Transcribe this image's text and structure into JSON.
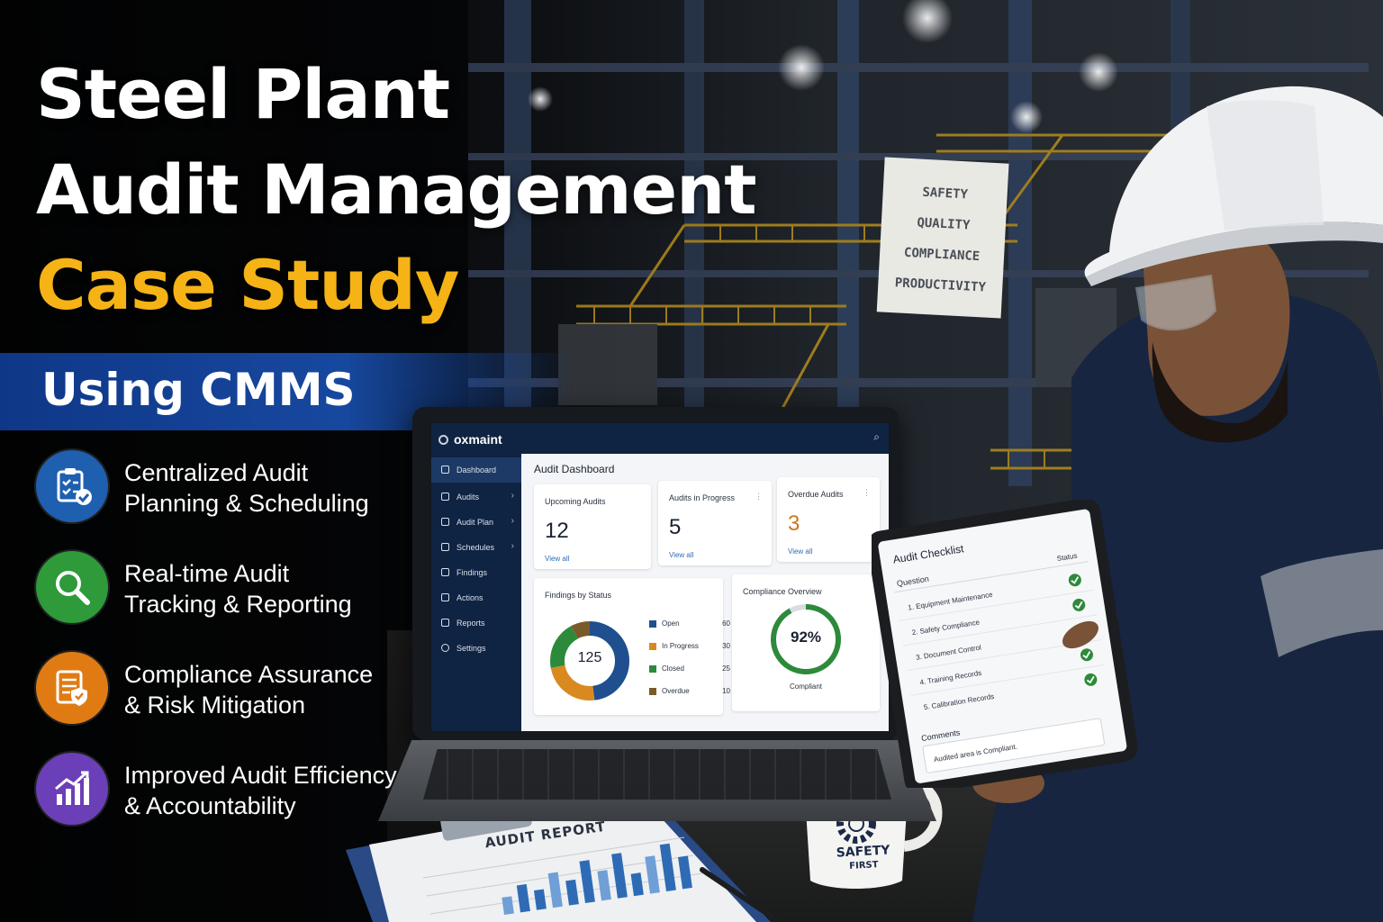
{
  "headline": {
    "line1": "Steel Plant",
    "line2": "Audit Management",
    "line3": "Case Study",
    "banner": "Using CMMS"
  },
  "features": [
    {
      "icon": "clipboard-check-icon",
      "color": "#1f5fb0",
      "line1": "Centralized Audit",
      "line2": "Planning & Scheduling"
    },
    {
      "icon": "magnifier-icon",
      "color": "#2e9a3a",
      "line1": "Real-time Audit",
      "line2": "Tracking & Reporting"
    },
    {
      "icon": "shield-document-icon",
      "color": "#e07b14",
      "line1": "Compliance Assurance",
      "line2": "& Risk Mitigation"
    },
    {
      "icon": "growth-chart-icon",
      "color": "#6b3fb8",
      "line1": "Improved Audit Efficiency",
      "line2": "& Accountability"
    }
  ],
  "sign": {
    "lines": [
      "SAFETY",
      "QUALITY",
      "COMPLIANCE",
      "PRODUCTIVITY"
    ]
  },
  "laptop": {
    "brand": "oxmaint",
    "search_icon": "⌕",
    "nav": [
      {
        "label": "Dashboard",
        "icon": "dashboard-icon"
      },
      {
        "label": "Audits",
        "icon": "audits-icon",
        "chevron": "›"
      },
      {
        "label": "Audit Plan",
        "icon": "plan-icon",
        "chevron": "›"
      },
      {
        "label": "Schedules",
        "icon": "calendar-icon",
        "chevron": "›"
      },
      {
        "label": "Findings",
        "icon": "findings-icon"
      },
      {
        "label": "Actions",
        "icon": "actions-icon"
      },
      {
        "label": "Reports",
        "icon": "reports-icon"
      },
      {
        "label": "Settings",
        "icon": "gear-icon"
      }
    ],
    "dashboard_title": "Audit Dashboard",
    "cards": [
      {
        "title": "Upcoming Audits",
        "value": "12",
        "link": "View all"
      },
      {
        "title": "Audits in Progress",
        "value": "5",
        "link": "View all",
        "menu": "⋮"
      },
      {
        "title": "Overdue Audits",
        "value": "3",
        "link": "View all",
        "menu": "⋮",
        "value_color": "#c9781b"
      }
    ],
    "findings": {
      "title": "Findings by Status",
      "total": "125",
      "items": [
        {
          "label": "Open",
          "value": 60,
          "color": "#1f4f8f"
        },
        {
          "label": "In Progress",
          "value": 30,
          "color": "#d88a20"
        },
        {
          "label": "Closed",
          "value": 25,
          "color": "#2d8a3a"
        },
        {
          "label": "Overdue",
          "value": 10,
          "color": "#7a5a2a"
        }
      ]
    },
    "compliance": {
      "title": "Compliance Overview",
      "value": "92%",
      "fraction": 0.92,
      "label": "Compliant"
    }
  },
  "tablet": {
    "title": "Audit Checklist",
    "col_question": "Question",
    "col_status": "Status",
    "items": [
      "1. Equipment Maintenance",
      "2. Safety Compliance",
      "3. Document Control",
      "4. Training Records",
      "5. Calibration Records"
    ],
    "comments_label": "Comments",
    "comments_value": "Audited area is Compliant."
  },
  "mug": {
    "line1": "SAFETY",
    "line2": "FIRST"
  },
  "report": {
    "title": "AUDIT REPORT",
    "bars": [
      0.35,
      0.55,
      0.4,
      0.7,
      0.5,
      0.85,
      0.6,
      0.9,
      0.45,
      0.75,
      0.95,
      0.65
    ]
  }
}
